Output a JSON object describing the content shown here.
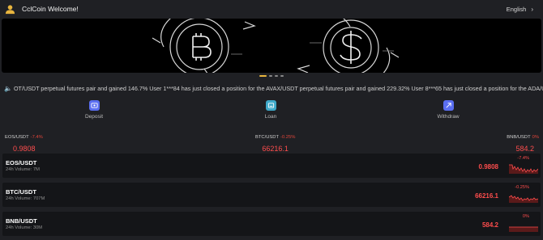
{
  "header": {
    "title": "CclCoin Welcome!",
    "language": "English"
  },
  "banner": {
    "slides": 4,
    "active_slide": 1
  },
  "marquee": {
    "text": "OT/USDT perpetual futures pair and gained 146.7% User 1***84 has just closed a position for the AVAX/USDT perpetual futures pair and gained 229.32% User 8***65 has just closed a position for the ADA/USDT pe"
  },
  "actions": [
    {
      "label": "Deposit",
      "icon": "deposit-icon"
    },
    {
      "label": "Loan",
      "icon": "loan-icon"
    },
    {
      "label": "Withdraw",
      "icon": "withdraw-icon"
    }
  ],
  "tickers": [
    {
      "pair": "EOS/USDT",
      "change": "-7.4%",
      "price": "0.9808"
    },
    {
      "pair": "BTC/USDT",
      "change": "-0.25%",
      "price": "66216.1"
    },
    {
      "pair": "BNB/USDT",
      "change": "0%",
      "price": "584.2"
    }
  ],
  "markets": [
    {
      "name": "EOS/USDT",
      "volume": "24h Volume: 7M",
      "price": "0.9808",
      "change": "-7.4%"
    },
    {
      "name": "BTC/USDT",
      "volume": "24h Volume: 707M",
      "price": "66216.1",
      "change": "-0.25%"
    },
    {
      "name": "BNB/USDT",
      "volume": "24h Volume: 30M",
      "price": "584.2",
      "change": "0%"
    }
  ],
  "colors": {
    "accent": "#e8b53e",
    "down": "#ff4d4d",
    "icon_bg": "#5a6ef0"
  }
}
